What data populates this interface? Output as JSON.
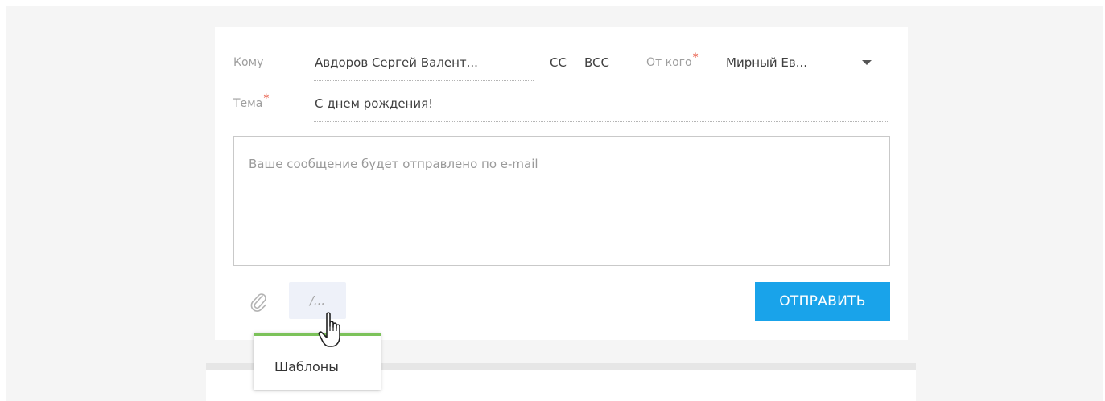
{
  "form": {
    "to_label": "Кому",
    "to_value": "Авдоров Сергей Валент...",
    "cc_label": "CC",
    "bcc_label": "BCC",
    "from_label": "От кого",
    "from_value": "Мирный Ев...",
    "subject_label": "Тема",
    "subject_value": "С днем рождения!",
    "required_mark": "*",
    "message_placeholder": "Ваше сообщение будет отправлено по e-mail"
  },
  "toolbar": {
    "attach_icon": "paperclip-icon",
    "templates_button_text": "/...",
    "send_label": "ОТПРАВИТЬ"
  },
  "tooltip": {
    "text": "Шаблоны"
  },
  "colors": {
    "accent": "#19a3ea",
    "required": "#e8543f",
    "tooltip_border": "#7cc25a"
  }
}
